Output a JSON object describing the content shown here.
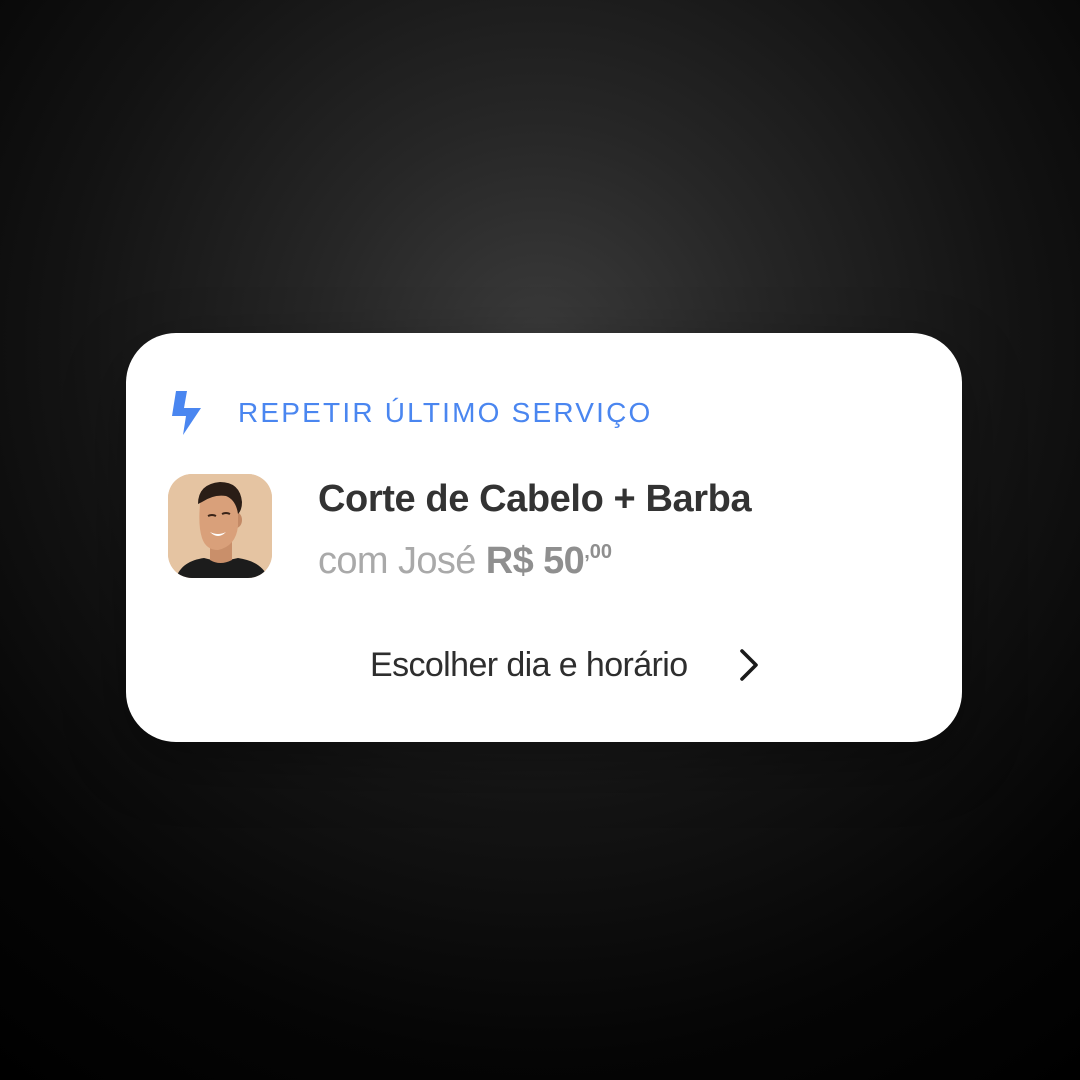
{
  "card": {
    "header_label": "REPETIR ÚLTIMO SERVIÇO",
    "header_icon": "lightning-bolt-icon",
    "accent_color": "#4a86f0",
    "service": {
      "title": "Corte de Cabelo + Barba",
      "with_label": "com José",
      "price_main": "R$ 50",
      "price_cents": ",00"
    },
    "action": {
      "label": "Escolher dia e horário",
      "icon": "chevron-right-icon"
    }
  }
}
